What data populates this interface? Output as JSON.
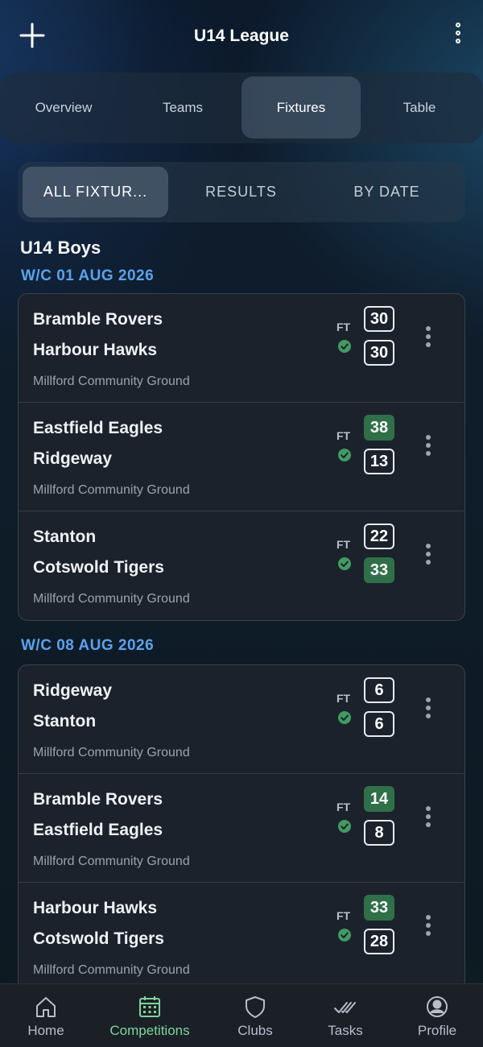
{
  "header": {
    "title": "U14 League",
    "add_icon": "plus-icon",
    "more_icon": "kebab-vertical-icon"
  },
  "tabs": [
    {
      "label": "Overview",
      "active": false
    },
    {
      "label": "Teams",
      "active": false
    },
    {
      "label": "Fixtures",
      "active": true
    },
    {
      "label": "Table",
      "active": false
    }
  ],
  "filters": [
    {
      "label": "ALL FIXTUR...",
      "active": true
    },
    {
      "label": "RESULTS",
      "active": false
    },
    {
      "label": "BY DATE",
      "active": false
    }
  ],
  "group_title": "U14 Boys",
  "weeks": [
    {
      "label": "W/C 01 AUG 2026",
      "fixtures": [
        {
          "home": "Bramble Rovers",
          "away": "Harbour Hawks",
          "home_score": "30",
          "away_score": "30",
          "status": "FT",
          "venue": "Millford Community Ground",
          "winner": "none"
        },
        {
          "home": "Eastfield Eagles",
          "away": "Ridgeway",
          "home_score": "38",
          "away_score": "13",
          "status": "FT",
          "venue": "Millford Community Ground",
          "winner": "home"
        },
        {
          "home": "Stanton",
          "away": "Cotswold Tigers",
          "home_score": "22",
          "away_score": "33",
          "status": "FT",
          "venue": "Millford Community Ground",
          "winner": "away"
        }
      ]
    },
    {
      "label": "W/C 08 AUG 2026",
      "fixtures": [
        {
          "home": "Ridgeway",
          "away": "Stanton",
          "home_score": "6",
          "away_score": "6",
          "status": "FT",
          "venue": "Millford Community Ground",
          "winner": "none"
        },
        {
          "home": "Bramble Rovers",
          "away": "Eastfield Eagles",
          "home_score": "14",
          "away_score": "8",
          "status": "FT",
          "venue": "Millford Community Ground",
          "winner": "home"
        },
        {
          "home": "Harbour Hawks",
          "away": "Cotswold Tigers",
          "home_score": "33",
          "away_score": "28",
          "status": "FT",
          "venue": "Millford Community Ground",
          "winner": "home"
        }
      ]
    }
  ],
  "nav": [
    {
      "label": "Home",
      "icon": "home-icon",
      "active": false
    },
    {
      "label": "Competitions",
      "icon": "calendar-icon",
      "active": true
    },
    {
      "label": "Clubs",
      "icon": "shield-icon",
      "active": false
    },
    {
      "label": "Tasks",
      "icon": "double-check-icon",
      "active": false
    },
    {
      "label": "Profile",
      "icon": "user-circle-icon",
      "active": false
    }
  ],
  "colors": {
    "accent_blue": "#5aa2ee",
    "win_green": "#2f7048",
    "check_green": "#3f9c62",
    "nav_active": "#7fd49a"
  }
}
